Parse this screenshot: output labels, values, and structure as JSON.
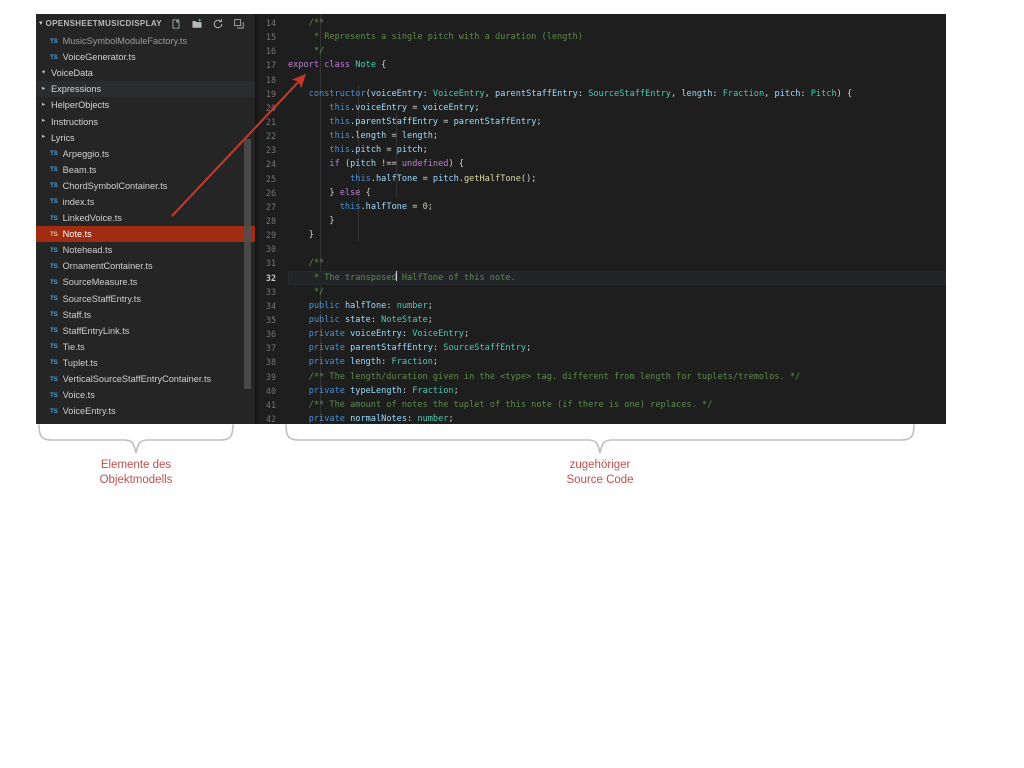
{
  "colors": {
    "editor_bg": "#1e1e1e",
    "sidebar_bg": "#252526",
    "selection_red": "#a02c12",
    "annotation_red": "#c0504d",
    "brace_gray": "#bfbfbf",
    "arrow_red": "#c0392b",
    "ts_badge_blue": "#4a9fd8"
  },
  "sidebar": {
    "title": "OPENSHEETMUSICDISPLAY",
    "collapse_chevron": "▾",
    "actions": [
      {
        "name": "new-file-icon",
        "tooltip": "New File"
      },
      {
        "name": "new-folder-icon",
        "tooltip": "New Folder"
      },
      {
        "name": "refresh-icon",
        "tooltip": "Refresh Explorer"
      },
      {
        "name": "collapse-all-icon",
        "tooltip": "Collapse Folders in Explorer"
      }
    ],
    "items": [
      {
        "label": "MusicSymbolModuleFactory.ts",
        "kind": "file",
        "badge": "TS",
        "state": "clipped"
      },
      {
        "label": "VoiceGenerator.ts",
        "kind": "file",
        "badge": "TS",
        "state": "normal"
      },
      {
        "label": "VoiceData",
        "kind": "folder",
        "twisty": "▾",
        "state": "expanded"
      },
      {
        "label": "Expressions",
        "kind": "folder",
        "twisty": "▸",
        "state": "hovered"
      },
      {
        "label": "HelperObjects",
        "kind": "folder",
        "twisty": "▸",
        "state": "collapsed"
      },
      {
        "label": "Instructions",
        "kind": "folder",
        "twisty": "▸",
        "state": "collapsed"
      },
      {
        "label": "Lyrics",
        "kind": "folder",
        "twisty": "▸",
        "state": "collapsed"
      },
      {
        "label": "Arpeggio.ts",
        "kind": "file",
        "badge": "TS",
        "state": "normal"
      },
      {
        "label": "Beam.ts",
        "kind": "file",
        "badge": "TS",
        "state": "normal"
      },
      {
        "label": "ChordSymbolContainer.ts",
        "kind": "file",
        "badge": "TS",
        "state": "normal"
      },
      {
        "label": "index.ts",
        "kind": "file",
        "badge": "TS",
        "state": "normal"
      },
      {
        "label": "LinkedVoice.ts",
        "kind": "file",
        "badge": "TS",
        "state": "normal"
      },
      {
        "label": "Note.ts",
        "kind": "file",
        "badge": "TS",
        "state": "selected"
      },
      {
        "label": "Notehead.ts",
        "kind": "file",
        "badge": "TS",
        "state": "normal"
      },
      {
        "label": "OrnamentContainer.ts",
        "kind": "file",
        "badge": "TS",
        "state": "normal"
      },
      {
        "label": "SourceMeasure.ts",
        "kind": "file",
        "badge": "TS",
        "state": "normal"
      },
      {
        "label": "SourceStaffEntry.ts",
        "kind": "file",
        "badge": "TS",
        "state": "normal"
      },
      {
        "label": "Staff.ts",
        "kind": "file",
        "badge": "TS",
        "state": "normal"
      },
      {
        "label": "StaffEntryLink.ts",
        "kind": "file",
        "badge": "TS",
        "state": "normal"
      },
      {
        "label": "Tie.ts",
        "kind": "file",
        "badge": "TS",
        "state": "normal"
      },
      {
        "label": "Tuplet.ts",
        "kind": "file",
        "badge": "TS",
        "state": "normal"
      },
      {
        "label": "VerticalSourceStaffEntryContainer.ts",
        "kind": "file",
        "badge": "TS",
        "state": "normal"
      },
      {
        "label": "Voice.ts",
        "kind": "file",
        "badge": "TS",
        "state": "normal"
      },
      {
        "label": "VoiceEntry.ts",
        "kind": "file",
        "badge": "TS",
        "state": "normal"
      }
    ]
  },
  "editor": {
    "first_line_number": 14,
    "last_line_number": 42,
    "active_line_number": 32,
    "lines": [
      {
        "n": 14,
        "tokens": [
          {
            "t": "    ",
            "c": "t-pln"
          },
          {
            "t": "/**",
            "c": "t-com"
          }
        ]
      },
      {
        "n": 15,
        "tokens": [
          {
            "t": "     ",
            "c": "t-pln"
          },
          {
            "t": "* Represents a single pitch with a duration (length)",
            "c": "t-com"
          }
        ]
      },
      {
        "n": 16,
        "tokens": [
          {
            "t": "     ",
            "c": "t-pln"
          },
          {
            "t": "*/",
            "c": "t-com"
          }
        ]
      },
      {
        "n": 17,
        "tokens": [
          {
            "t": "export",
            "c": "t-kw"
          },
          {
            "t": " ",
            "c": "t-pln"
          },
          {
            "t": "class",
            "c": "t-kw"
          },
          {
            "t": " ",
            "c": "t-pln"
          },
          {
            "t": "Note",
            "c": "t-type"
          },
          {
            "t": " {",
            "c": "t-punct"
          }
        ]
      },
      {
        "n": 18,
        "tokens": []
      },
      {
        "n": 19,
        "tokens": [
          {
            "t": "    ",
            "c": "t-pln"
          },
          {
            "t": "constructor",
            "c": "t-mod"
          },
          {
            "t": "(",
            "c": "t-punct"
          },
          {
            "t": "voiceEntry",
            "c": "t-var"
          },
          {
            "t": ": ",
            "c": "t-punct"
          },
          {
            "t": "VoiceEntry",
            "c": "t-type"
          },
          {
            "t": ", ",
            "c": "t-punct"
          },
          {
            "t": "parentStaffEntry",
            "c": "t-var"
          },
          {
            "t": ": ",
            "c": "t-punct"
          },
          {
            "t": "SourceStaffEntry",
            "c": "t-type"
          },
          {
            "t": ", ",
            "c": "t-punct"
          },
          {
            "t": "length",
            "c": "t-var"
          },
          {
            "t": ": ",
            "c": "t-punct"
          },
          {
            "t": "Fraction",
            "c": "t-type"
          },
          {
            "t": ", ",
            "c": "t-punct"
          },
          {
            "t": "pitch",
            "c": "t-var"
          },
          {
            "t": ": ",
            "c": "t-punct"
          },
          {
            "t": "Pitch",
            "c": "t-type"
          },
          {
            "t": ") {",
            "c": "t-punct"
          }
        ]
      },
      {
        "n": 20,
        "tokens": [
          {
            "t": "        ",
            "c": "t-pln"
          },
          {
            "t": "this",
            "c": "t-this"
          },
          {
            "t": ".",
            "c": "t-punct"
          },
          {
            "t": "voiceEntry",
            "c": "t-var"
          },
          {
            "t": " = ",
            "c": "t-punct"
          },
          {
            "t": "voiceEntry",
            "c": "t-var"
          },
          {
            "t": ";",
            "c": "t-punct"
          }
        ]
      },
      {
        "n": 21,
        "tokens": [
          {
            "t": "        ",
            "c": "t-pln"
          },
          {
            "t": "this",
            "c": "t-this"
          },
          {
            "t": ".",
            "c": "t-punct"
          },
          {
            "t": "parentStaffEntry",
            "c": "t-var"
          },
          {
            "t": " = ",
            "c": "t-punct"
          },
          {
            "t": "parentStaffEntry",
            "c": "t-var"
          },
          {
            "t": ";",
            "c": "t-punct"
          }
        ]
      },
      {
        "n": 22,
        "tokens": [
          {
            "t": "        ",
            "c": "t-pln"
          },
          {
            "t": "this",
            "c": "t-this"
          },
          {
            "t": ".",
            "c": "t-punct"
          },
          {
            "t": "length",
            "c": "t-var"
          },
          {
            "t": " = ",
            "c": "t-punct"
          },
          {
            "t": "length",
            "c": "t-var"
          },
          {
            "t": ";",
            "c": "t-punct"
          }
        ]
      },
      {
        "n": 23,
        "tokens": [
          {
            "t": "        ",
            "c": "t-pln"
          },
          {
            "t": "this",
            "c": "t-this"
          },
          {
            "t": ".",
            "c": "t-punct"
          },
          {
            "t": "pitch",
            "c": "t-var"
          },
          {
            "t": " = ",
            "c": "t-punct"
          },
          {
            "t": "pitch",
            "c": "t-var"
          },
          {
            "t": ";",
            "c": "t-punct"
          }
        ]
      },
      {
        "n": 24,
        "tokens": [
          {
            "t": "        ",
            "c": "t-pln"
          },
          {
            "t": "if",
            "c": "t-ctl"
          },
          {
            "t": " (",
            "c": "t-punct"
          },
          {
            "t": "pitch",
            "c": "t-var"
          },
          {
            "t": " !== ",
            "c": "t-punct"
          },
          {
            "t": "undefined",
            "c": "t-kw"
          },
          {
            "t": ") {",
            "c": "t-punct"
          }
        ]
      },
      {
        "n": 25,
        "tokens": [
          {
            "t": "            ",
            "c": "t-pln"
          },
          {
            "t": "this",
            "c": "t-this"
          },
          {
            "t": ".",
            "c": "t-punct"
          },
          {
            "t": "halfTone",
            "c": "t-var"
          },
          {
            "t": " = ",
            "c": "t-punct"
          },
          {
            "t": "pitch",
            "c": "t-var"
          },
          {
            "t": ".",
            "c": "t-punct"
          },
          {
            "t": "getHalfTone",
            "c": "t-fn"
          },
          {
            "t": "();",
            "c": "t-punct"
          }
        ]
      },
      {
        "n": 26,
        "tokens": [
          {
            "t": "        } ",
            "c": "t-punct"
          },
          {
            "t": "else",
            "c": "t-ctl"
          },
          {
            "t": " {",
            "c": "t-punct"
          }
        ]
      },
      {
        "n": 27,
        "tokens": [
          {
            "t": "          ",
            "c": "t-pln"
          },
          {
            "t": "this",
            "c": "t-this"
          },
          {
            "t": ".",
            "c": "t-punct"
          },
          {
            "t": "halfTone",
            "c": "t-var"
          },
          {
            "t": " = ",
            "c": "t-punct"
          },
          {
            "t": "0",
            "c": "t-num"
          },
          {
            "t": ";",
            "c": "t-punct"
          }
        ]
      },
      {
        "n": 28,
        "tokens": [
          {
            "t": "        }",
            "c": "t-punct"
          }
        ]
      },
      {
        "n": 29,
        "tokens": [
          {
            "t": "    }",
            "c": "t-punct"
          }
        ]
      },
      {
        "n": 30,
        "tokens": []
      },
      {
        "n": 31,
        "tokens": [
          {
            "t": "    ",
            "c": "t-pln"
          },
          {
            "t": "/**",
            "c": "t-com"
          }
        ]
      },
      {
        "n": 32,
        "tokens": [
          {
            "t": "     ",
            "c": "t-pln"
          },
          {
            "t": "* The transposed",
            "c": "t-com"
          },
          {
            "t": "CURSOR",
            "c": "cursor"
          },
          {
            "t": " HalfTone of this note.",
            "c": "t-com"
          }
        ]
      },
      {
        "n": 33,
        "tokens": [
          {
            "t": "     ",
            "c": "t-pln"
          },
          {
            "t": "*/",
            "c": "t-com"
          }
        ]
      },
      {
        "n": 34,
        "tokens": [
          {
            "t": "    ",
            "c": "t-pln"
          },
          {
            "t": "public",
            "c": "t-mod"
          },
          {
            "t": " ",
            "c": "t-pln"
          },
          {
            "t": "halfTone",
            "c": "t-var"
          },
          {
            "t": ": ",
            "c": "t-punct"
          },
          {
            "t": "number",
            "c": "t-type"
          },
          {
            "t": ";",
            "c": "t-punct"
          }
        ]
      },
      {
        "n": 35,
        "tokens": [
          {
            "t": "    ",
            "c": "t-pln"
          },
          {
            "t": "public",
            "c": "t-mod"
          },
          {
            "t": " ",
            "c": "t-pln"
          },
          {
            "t": "state",
            "c": "t-var"
          },
          {
            "t": ": ",
            "c": "t-punct"
          },
          {
            "t": "NoteState",
            "c": "t-type"
          },
          {
            "t": ";",
            "c": "t-punct"
          }
        ]
      },
      {
        "n": 36,
        "tokens": [
          {
            "t": "    ",
            "c": "t-pln"
          },
          {
            "t": "private",
            "c": "t-mod"
          },
          {
            "t": " ",
            "c": "t-pln"
          },
          {
            "t": "voiceEntry",
            "c": "t-var"
          },
          {
            "t": ": ",
            "c": "t-punct"
          },
          {
            "t": "VoiceEntry",
            "c": "t-type"
          },
          {
            "t": ";",
            "c": "t-punct"
          }
        ]
      },
      {
        "n": 37,
        "tokens": [
          {
            "t": "    ",
            "c": "t-pln"
          },
          {
            "t": "private",
            "c": "t-mod"
          },
          {
            "t": " ",
            "c": "t-pln"
          },
          {
            "t": "parentStaffEntry",
            "c": "t-var"
          },
          {
            "t": ": ",
            "c": "t-punct"
          },
          {
            "t": "SourceStaffEntry",
            "c": "t-type"
          },
          {
            "t": ";",
            "c": "t-punct"
          }
        ]
      },
      {
        "n": 38,
        "tokens": [
          {
            "t": "    ",
            "c": "t-pln"
          },
          {
            "t": "private",
            "c": "t-mod"
          },
          {
            "t": " ",
            "c": "t-pln"
          },
          {
            "t": "length",
            "c": "t-var"
          },
          {
            "t": ": ",
            "c": "t-punct"
          },
          {
            "t": "Fraction",
            "c": "t-type"
          },
          {
            "t": ";",
            "c": "t-punct"
          }
        ]
      },
      {
        "n": 39,
        "tokens": [
          {
            "t": "    ",
            "c": "t-pln"
          },
          {
            "t": "/** The length/duration given in the <type> tag. different from length for tuplets/tremolos. */",
            "c": "t-com"
          }
        ]
      },
      {
        "n": 40,
        "tokens": [
          {
            "t": "    ",
            "c": "t-pln"
          },
          {
            "t": "private",
            "c": "t-mod"
          },
          {
            "t": " ",
            "c": "t-pln"
          },
          {
            "t": "typeLength",
            "c": "t-var"
          },
          {
            "t": ": ",
            "c": "t-punct"
          },
          {
            "t": "Fraction",
            "c": "t-type"
          },
          {
            "t": ";",
            "c": "t-punct"
          }
        ]
      },
      {
        "n": 41,
        "tokens": [
          {
            "t": "    ",
            "c": "t-pln"
          },
          {
            "t": "/** The amount of notes the tuplet of this note (if there is one) replaces. */",
            "c": "t-com"
          }
        ]
      },
      {
        "n": 42,
        "tokens": [
          {
            "t": "    ",
            "c": "t-pln"
          },
          {
            "t": "private",
            "c": "t-mod"
          },
          {
            "t": " ",
            "c": "t-pln"
          },
          {
            "t": "normalNotes",
            "c": "t-var"
          },
          {
            "t": ": ",
            "c": "t-punct"
          },
          {
            "t": "number",
            "c": "t-type"
          },
          {
            "t": ";",
            "c": "t-punct"
          }
        ]
      }
    ]
  },
  "annotations": {
    "arrow": {
      "name": "pointer-arrow",
      "from_label": "Note.ts",
      "to_label": "export class Note {"
    },
    "left_caption": "Elemente des\nObjektmodells",
    "right_caption": "zugehöriger\nSource Code"
  }
}
